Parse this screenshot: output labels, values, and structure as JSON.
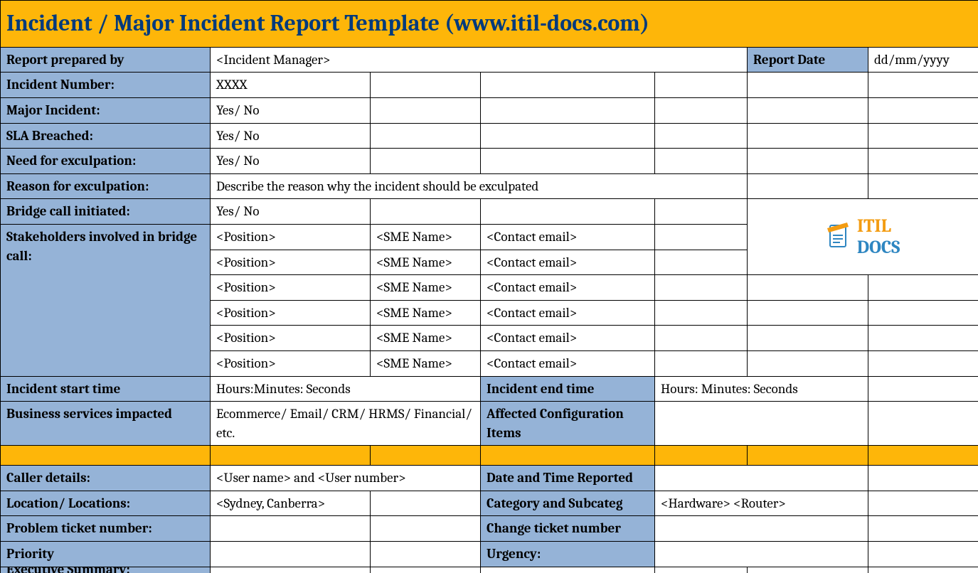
{
  "title": "Incident / Major Incident Report Template   (www.itil-docs.com)",
  "labels": {
    "report_prepared_by": "Report prepared by",
    "report_date": "Report Date",
    "incident_number": "Incident Number:",
    "major_incident": "Major Incident:",
    "sla_breached": "SLA Breached:",
    "need_exculpation": "Need for exculpation:",
    "reason_exculpation": "Reason for exculpation:",
    "bridge_call": "Bridge call initiated:",
    "stakeholders": "Stakeholders involved in bridge call:",
    "incident_start": "Incident start time",
    "incident_end": "Incident end time",
    "business_services": "Business services impacted",
    "affected_ci": "Affected Configuration Items",
    "caller_details": "Caller details:",
    "date_time_reported": "Date and Time Reported",
    "location": "Location/ Locations:",
    "category_subcat": "Category and Subcateg",
    "problem_ticket": "Problem ticket number:",
    "change_ticket": "Change ticket number",
    "priority": "Priority",
    "urgency": "Urgency:",
    "exec_summary": "Executive Summary:"
  },
  "values": {
    "report_prepared_by": "<Incident Manager>",
    "report_date": "dd/mm/yyyy",
    "incident_number": "XXXX",
    "major_incident": "Yes/ No",
    "sla_breached": "Yes/ No",
    "need_exculpation": "Yes/ No",
    "reason_exculpation": "Describe the reason why the incident should be exculpated",
    "bridge_call": "Yes/ No",
    "incident_start": "Hours:Minutes: Seconds",
    "incident_end": "Hours: Minutes: Seconds",
    "business_services": "Ecommerce/ Email/ CRM/ HRMS/ Financial/ etc.",
    "caller_details": "<User name> and <User number>",
    "location": "<Sydney, Canberra>",
    "category_subcat": "<Hardware> <Router>"
  },
  "stakeholders": [
    {
      "position": "<Position>",
      "sme": "<SME Name>",
      "email": "<Contact email>"
    },
    {
      "position": "<Position>",
      "sme": "<SME Name>",
      "email": "<Contact email>"
    },
    {
      "position": "<Position>",
      "sme": "<SME Name>",
      "email": "<Contact email>"
    },
    {
      "position": "<Position>",
      "sme": "<SME Name>",
      "email": "<Contact email>"
    },
    {
      "position": "<Position>",
      "sme": "<SME Name>",
      "email": "<Contact email>"
    },
    {
      "position": "<Position>",
      "sme": "<SME Name>",
      "email": "<Contact email>"
    }
  ],
  "logo": {
    "itil": "ITIL",
    "docs": "DOCS"
  }
}
